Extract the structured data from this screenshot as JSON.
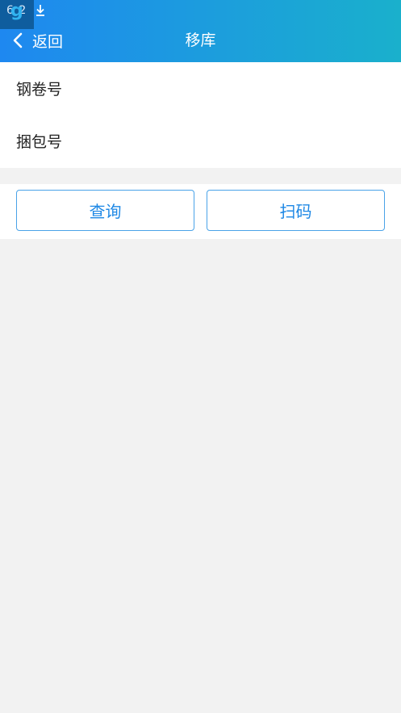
{
  "status_bar": {
    "time_fragment": "6 2",
    "app_badge": "g"
  },
  "header": {
    "back_label": "返回",
    "title": "移库",
    "colors": {
      "gradient_start": "#1e88f0",
      "gradient_end": "#1ab0cc"
    }
  },
  "form": {
    "fields": [
      {
        "label": "钢卷号",
        "value": "",
        "placeholder": ""
      },
      {
        "label": "捆包号",
        "value": "",
        "placeholder": ""
      }
    ]
  },
  "actions": {
    "query_label": "查询",
    "scan_label": "扫码",
    "accent_color": "#1e88e5"
  }
}
